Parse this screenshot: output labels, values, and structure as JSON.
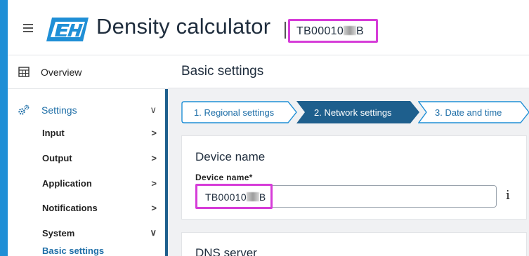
{
  "header": {
    "app_title": "Density calculator",
    "device_tag": "TB00010",
    "device_tag_suffix": "B",
    "logo_text": "EH",
    "menu_icon": "hamburger-menu-icon"
  },
  "sidebar": {
    "overview_label": "Overview",
    "overview_icon": "table-grid-icon",
    "settings_label": "Settings",
    "settings_icon": "gears-icon",
    "items": [
      {
        "label": "Input",
        "chevron": ">"
      },
      {
        "label": "Output",
        "chevron": ">"
      },
      {
        "label": "Application",
        "chevron": ">"
      },
      {
        "label": "Notifications",
        "chevron": ">"
      },
      {
        "label": "System",
        "chevron": "∨"
      }
    ],
    "active_sub_item": "Basic settings",
    "settings_chevron": "∨"
  },
  "main": {
    "page_title": "Basic settings",
    "steps": [
      {
        "label": "1. Regional settings",
        "state": "done"
      },
      {
        "label": "2. Network settings",
        "state": "active"
      },
      {
        "label": "3. Date and time",
        "state": "pending"
      }
    ],
    "device_card": {
      "title": "Device name",
      "field_label": "Device name*",
      "field_value_prefix": "TB00010",
      "field_value_suffix": "B",
      "info": "i"
    },
    "dns_card": {
      "title": "DNS server"
    }
  },
  "colors": {
    "brand_blue": "#1f8fd6",
    "active_step": "#1e5f8d",
    "highlight": "#d63cd8"
  }
}
